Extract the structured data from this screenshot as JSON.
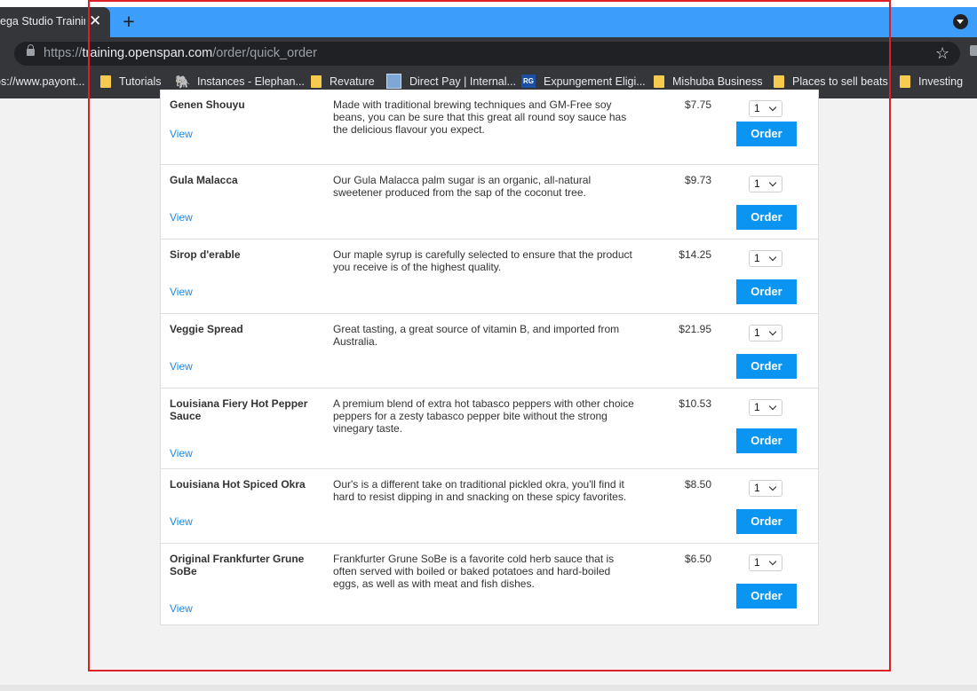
{
  "browser": {
    "tab_title": "ega Studio Trainin",
    "tab_close": "✕",
    "new_tab": "+",
    "url_prefix": "https://",
    "url_host": "training.openspan.com",
    "url_path": "/order/quick_order",
    "star": "☆",
    "accent_color": "#3d9dfb"
  },
  "bookmarks": [
    {
      "label": "ps://www.payont...",
      "icon": "none"
    },
    {
      "label": "Tutorials",
      "icon": "folder-icon"
    },
    {
      "label": "Instances - Elephan...",
      "icon": "elephant-icon"
    },
    {
      "label": "Revature",
      "icon": "folder-icon"
    },
    {
      "label": "Direct Pay | Internal...",
      "icon": "directpay-icon"
    },
    {
      "label": "Expungement Eligi...",
      "icon": "rg-icon",
      "icon_text": "RG"
    },
    {
      "label": "Mishuba Business",
      "icon": "folder-icon"
    },
    {
      "label": "Places to sell beats",
      "icon": "folder-icon"
    },
    {
      "label": "Investing",
      "icon": "folder-icon"
    }
  ],
  "products": [
    {
      "name": "Genen Shouyu",
      "description": "Made with traditional brewing techniques and GM-Free soy beans, you can be sure that this great all round soy sauce has the delicious flavour you expect.",
      "price": "$7.75",
      "qty": "1",
      "view": "View",
      "order": "Order"
    },
    {
      "name": "Gula Malacca",
      "description": "Our Gula Malacca palm sugar is an organic, all-natural sweetener produced from the sap of the coconut tree.",
      "price": "$9.73",
      "qty": "1",
      "view": "View",
      "order": "Order"
    },
    {
      "name": "Sirop d'erable",
      "description": "Our maple syrup is carefully selected to ensure that the product you receive is of the highest quality.",
      "price": "$14.25",
      "qty": "1",
      "view": "View",
      "order": "Order"
    },
    {
      "name": "Veggie Spread",
      "description": "Great tasting, a great source of vitamin B, and imported from Australia.",
      "price": "$21.95",
      "qty": "1",
      "view": "View",
      "order": "Order"
    },
    {
      "name": "Louisiana Fiery Hot Pepper Sauce",
      "description": "A premium blend of extra hot tabasco peppers with other choice peppers for a zesty tabasco pepper bite without the strong vinegary taste.",
      "price": "$10.53",
      "qty": "1",
      "view": "View",
      "order": "Order"
    },
    {
      "name": "Louisiana Hot Spiced Okra",
      "description": "Our's is a different take on traditional pickled okra, you'll find it hard to resist dipping in and snacking on these spicy favorites.",
      "price": "$8.50",
      "qty": "1",
      "view": "View",
      "order": "Order"
    },
    {
      "name": "Original Frankfurter Grune SoBe",
      "description": "Frankfurter Grune SoBe is a favorite cold herb sauce that is often served with boiled or baked potatoes and hard-boiled eggs, as well as with meat and fish dishes.",
      "price": "$6.50",
      "qty": "1",
      "view": "View",
      "order": "Order"
    }
  ]
}
